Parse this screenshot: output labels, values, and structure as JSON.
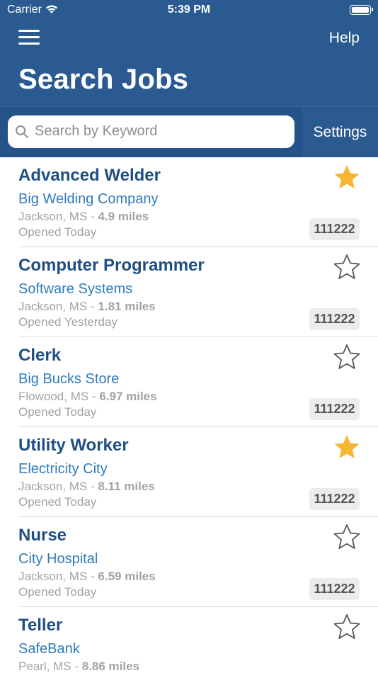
{
  "status_bar": {
    "carrier": "Carrier",
    "time": "5:39 PM"
  },
  "header": {
    "help_label": "Help",
    "title": "Search Jobs"
  },
  "search": {
    "placeholder": "Search by Keyword",
    "settings_label": "Settings"
  },
  "colors": {
    "header": "#2a5a8f",
    "title_text": "#1f4f82",
    "company_text": "#2f7bbd",
    "star_filled": "#f5b731",
    "star_outline": "#555555"
  },
  "jobs": [
    {
      "title": "Advanced Welder",
      "company": "Big Welding Company",
      "location": "Jackson, MS",
      "distance": "4.9 miles",
      "opened": "Opened Today",
      "job_id": "111222",
      "starred": true
    },
    {
      "title": "Computer Programmer",
      "company": "Software Systems",
      "location": "Jackson, MS",
      "distance": "1.81 miles",
      "opened": "Opened Yesterday",
      "job_id": "111222",
      "starred": false
    },
    {
      "title": "Clerk",
      "company": "Big Bucks Store",
      "location": "Flowood, MS",
      "distance": "6.97 miles",
      "opened": "Opened Today",
      "job_id": "111222",
      "starred": false
    },
    {
      "title": "Utility Worker",
      "company": "Electricity City",
      "location": "Jackson, MS",
      "distance": "8.11 miles",
      "opened": "Opened Today",
      "job_id": "111222",
      "starred": true
    },
    {
      "title": "Nurse",
      "company": "City Hospital",
      "location": "Jackson, MS",
      "distance": "6.59 miles",
      "opened": "Opened Today",
      "job_id": "111222",
      "starred": false
    },
    {
      "title": "Teller",
      "company": "SafeBank",
      "location": "Pearl, MS",
      "distance": "8.86 miles",
      "opened": "",
      "job_id": "",
      "starred": false
    }
  ],
  "separator": " - "
}
